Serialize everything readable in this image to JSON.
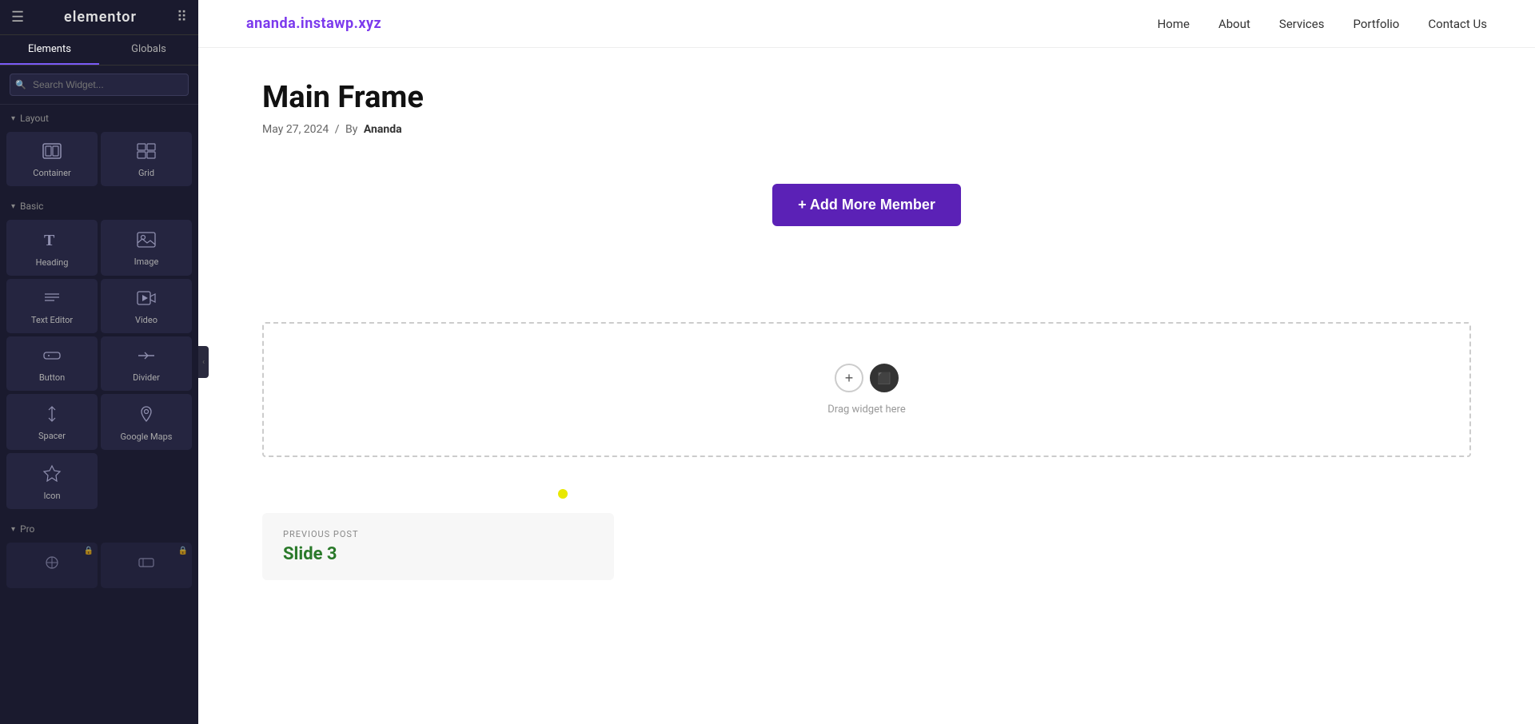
{
  "sidebar": {
    "logo": "elementor",
    "tabs": [
      {
        "id": "elements",
        "label": "Elements",
        "active": true
      },
      {
        "id": "globals",
        "label": "Globals",
        "active": false
      }
    ],
    "search": {
      "placeholder": "Search Widget..."
    },
    "sections": [
      {
        "id": "layout",
        "label": "Layout",
        "widgets": [
          {
            "id": "container",
            "label": "Container",
            "icon": "⬜"
          },
          {
            "id": "grid",
            "label": "Grid",
            "icon": "⊞"
          }
        ]
      },
      {
        "id": "basic",
        "label": "Basic",
        "widgets": [
          {
            "id": "heading",
            "label": "Heading",
            "icon": "T"
          },
          {
            "id": "image",
            "label": "Image",
            "icon": "🖼"
          },
          {
            "id": "text-editor",
            "label": "Text Editor",
            "icon": "≡"
          },
          {
            "id": "video",
            "label": "Video",
            "icon": "▶"
          },
          {
            "id": "button",
            "label": "Button",
            "icon": "⬡"
          },
          {
            "id": "divider",
            "label": "Divider",
            "icon": "⊟"
          },
          {
            "id": "spacer",
            "label": "Spacer",
            "icon": "↕"
          },
          {
            "id": "google-maps",
            "label": "Google Maps",
            "icon": "📍"
          },
          {
            "id": "icon",
            "label": "Icon",
            "icon": "★"
          }
        ]
      },
      {
        "id": "pro",
        "label": "Pro",
        "widgets": [
          {
            "id": "pro-widget-1",
            "label": "",
            "icon": "⌖",
            "locked": true
          },
          {
            "id": "pro-widget-2",
            "label": "",
            "icon": "▭",
            "locked": true
          }
        ]
      }
    ]
  },
  "topnav": {
    "logo": "ananda.instawp.xyz",
    "links": [
      {
        "id": "home",
        "label": "Home"
      },
      {
        "id": "about",
        "label": "About"
      },
      {
        "id": "services",
        "label": "Services"
      },
      {
        "id": "portfolio",
        "label": "Portfolio"
      },
      {
        "id": "contact",
        "label": "Contact Us"
      }
    ]
  },
  "page": {
    "title": "Main Frame",
    "meta_date": "May 27, 2024",
    "meta_separator": "/",
    "meta_by": "By",
    "meta_author": "Ananda"
  },
  "add_member_btn": {
    "label": "+ Add More Member"
  },
  "drop_zone": {
    "hint": "Drag widget here"
  },
  "post_nav": {
    "label": "PREVIOUS POST",
    "title": "Slide 3"
  },
  "colors": {
    "accent": "#5b21b6",
    "logo_color": "#6633cc",
    "nav_logo_color": "#7c3aed"
  }
}
